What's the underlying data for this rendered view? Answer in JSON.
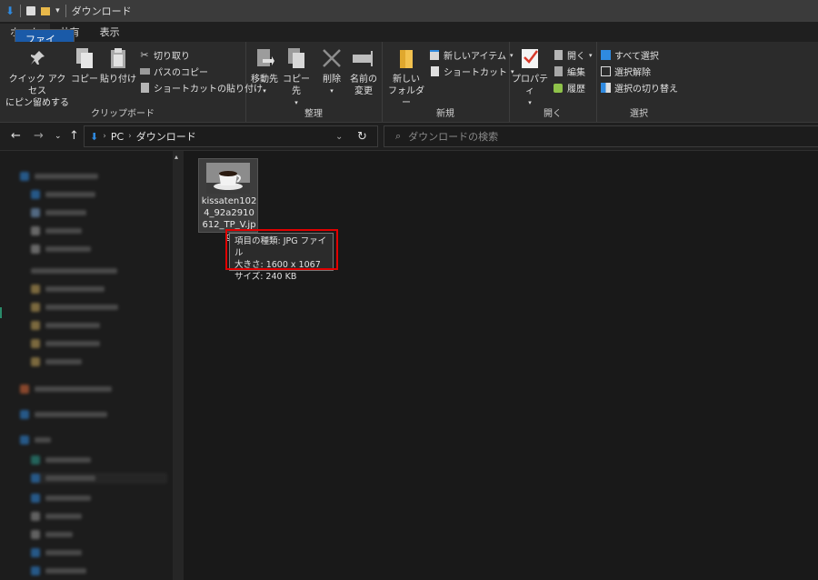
{
  "titlebar": {
    "title": "ダウンロード"
  },
  "tabs": [
    {
      "label": "ファイル"
    },
    {
      "label": "ホーム"
    },
    {
      "label": "共有"
    },
    {
      "label": "表示"
    }
  ],
  "ribbon": {
    "clipboard": {
      "label": "クリップボード",
      "pin_line1": "クイック アクセス",
      "pin_line2": "にピン留めする",
      "copy": "コピー",
      "paste": "貼り付け",
      "cut": "切り取り",
      "copy_path": "パスのコピー",
      "paste_shortcut": "ショートカットの貼り付け"
    },
    "organize": {
      "label": "整理",
      "move_to": "移動先",
      "copy_to": "コピー先",
      "delete": "削除",
      "rename_line1": "名前の",
      "rename_line2": "変更"
    },
    "new": {
      "label": "新規",
      "new_folder_line1": "新しい",
      "new_folder_line2": "フォルダー",
      "new_item": "新しいアイテム",
      "shortcut": "ショートカット"
    },
    "open": {
      "label": "開く",
      "properties": "プロパティ",
      "open": "開く",
      "edit": "編集",
      "history": "履歴"
    },
    "select": {
      "label": "選択",
      "select_all": "すべて選択",
      "select_none": "選択解除",
      "invert": "選択の切り替え"
    }
  },
  "address": {
    "pc": "PC",
    "folder": "ダウンロード"
  },
  "search": {
    "placeholder": "ダウンロードの検索"
  },
  "file": {
    "name": "kissaten1024_92a2910612_TP_V.jpg"
  },
  "tooltip": {
    "type": "項目の種類: JPG ファイル",
    "size_px": "大きさ: 1600 x 1067",
    "filesize": "サイズ: 240 KB"
  },
  "colors": {
    "file_tab": "#1a5aa8",
    "highlight": "#e00000",
    "accent_blue": "#2f8ae0"
  }
}
